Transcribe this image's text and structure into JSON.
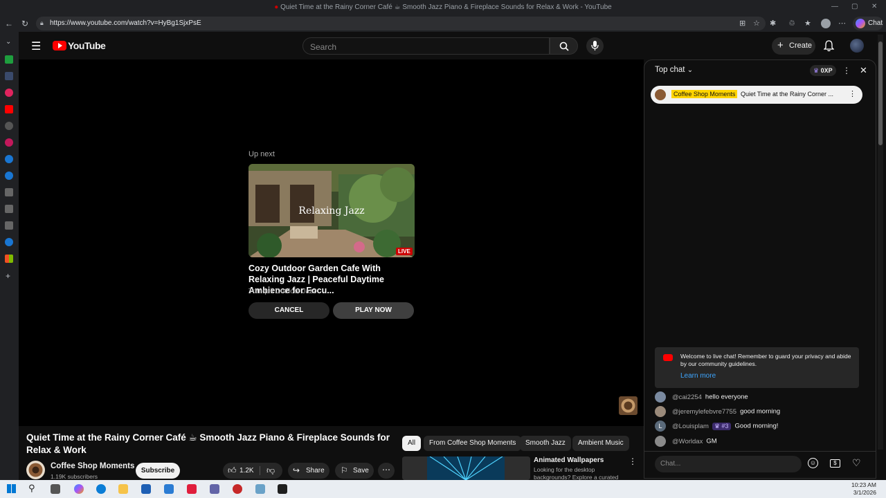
{
  "browser": {
    "tab_title": "Quiet Time at the Rainy Corner Café ☕ Smooth Jazz Piano & Fireplace Sounds for Relax & Work - YouTube",
    "url": "https://www.youtube.com/watch?v=HyBg1SjxPsE",
    "chat_button": "Chat"
  },
  "header": {
    "logo_text": "YouTube",
    "search_placeholder": "Search",
    "create_label": "Create"
  },
  "player": {
    "up_next_label": "Up next",
    "next_thumb_text": "Relaxing Jazz",
    "live_badge": "LIVE",
    "next_title": "Cozy Outdoor Garden Cafe With Relaxing Jazz | Peaceful Daytime Ambience for Focu...",
    "next_channel": "Tranquil Outdoor Jazz",
    "cancel_label": "CANCEL",
    "play_now_label": "PLAY NOW"
  },
  "video": {
    "title": "Quiet Time at the Rainy Corner Café ☕ Smooth Jazz Piano & Fireplace Sounds for Relax & Work",
    "channel_name": "Coffee Shop Moments",
    "subscribers": "1.19K subscribers",
    "subscribe_label": "Subscribe",
    "likes": "1.2K",
    "share_label": "Share",
    "save_label": "Save"
  },
  "chips": [
    "All",
    "From Coffee Shop Moments",
    "Smooth Jazz",
    "Ambient Music"
  ],
  "recommendation": {
    "title": "Animated Wallpapers",
    "description": "Looking for the desktop backgrounds? Explore a curated"
  },
  "chat": {
    "mode_label": "Top chat",
    "xp_label": "0XP",
    "pinned_channel": "Coffee Shop Moments",
    "pinned_text": "Quiet Time at the Rainy Corner ...",
    "welcome_text": "Welcome to live chat! Remember to guard your privacy and abide by our community guidelines.",
    "learn_more": "Learn more",
    "messages": [
      {
        "author": "@cai2254",
        "text": "hello everyone"
      },
      {
        "author": "@jeremylefebvre7755",
        "text": "good morning"
      },
      {
        "author": "@Louisplam",
        "badge": "#3",
        "text": "Good morning!"
      },
      {
        "author": "@Worldax",
        "text": "GM"
      }
    ],
    "louis_initial": "L",
    "input_placeholder": "Chat..."
  },
  "taskbar": {
    "time": "10:23 AM",
    "date": "3/1/2026"
  },
  "colors": {
    "accent_red": "#ff0000",
    "link_blue": "#3ea6ff",
    "pinned_highlight": "#ffd400"
  }
}
